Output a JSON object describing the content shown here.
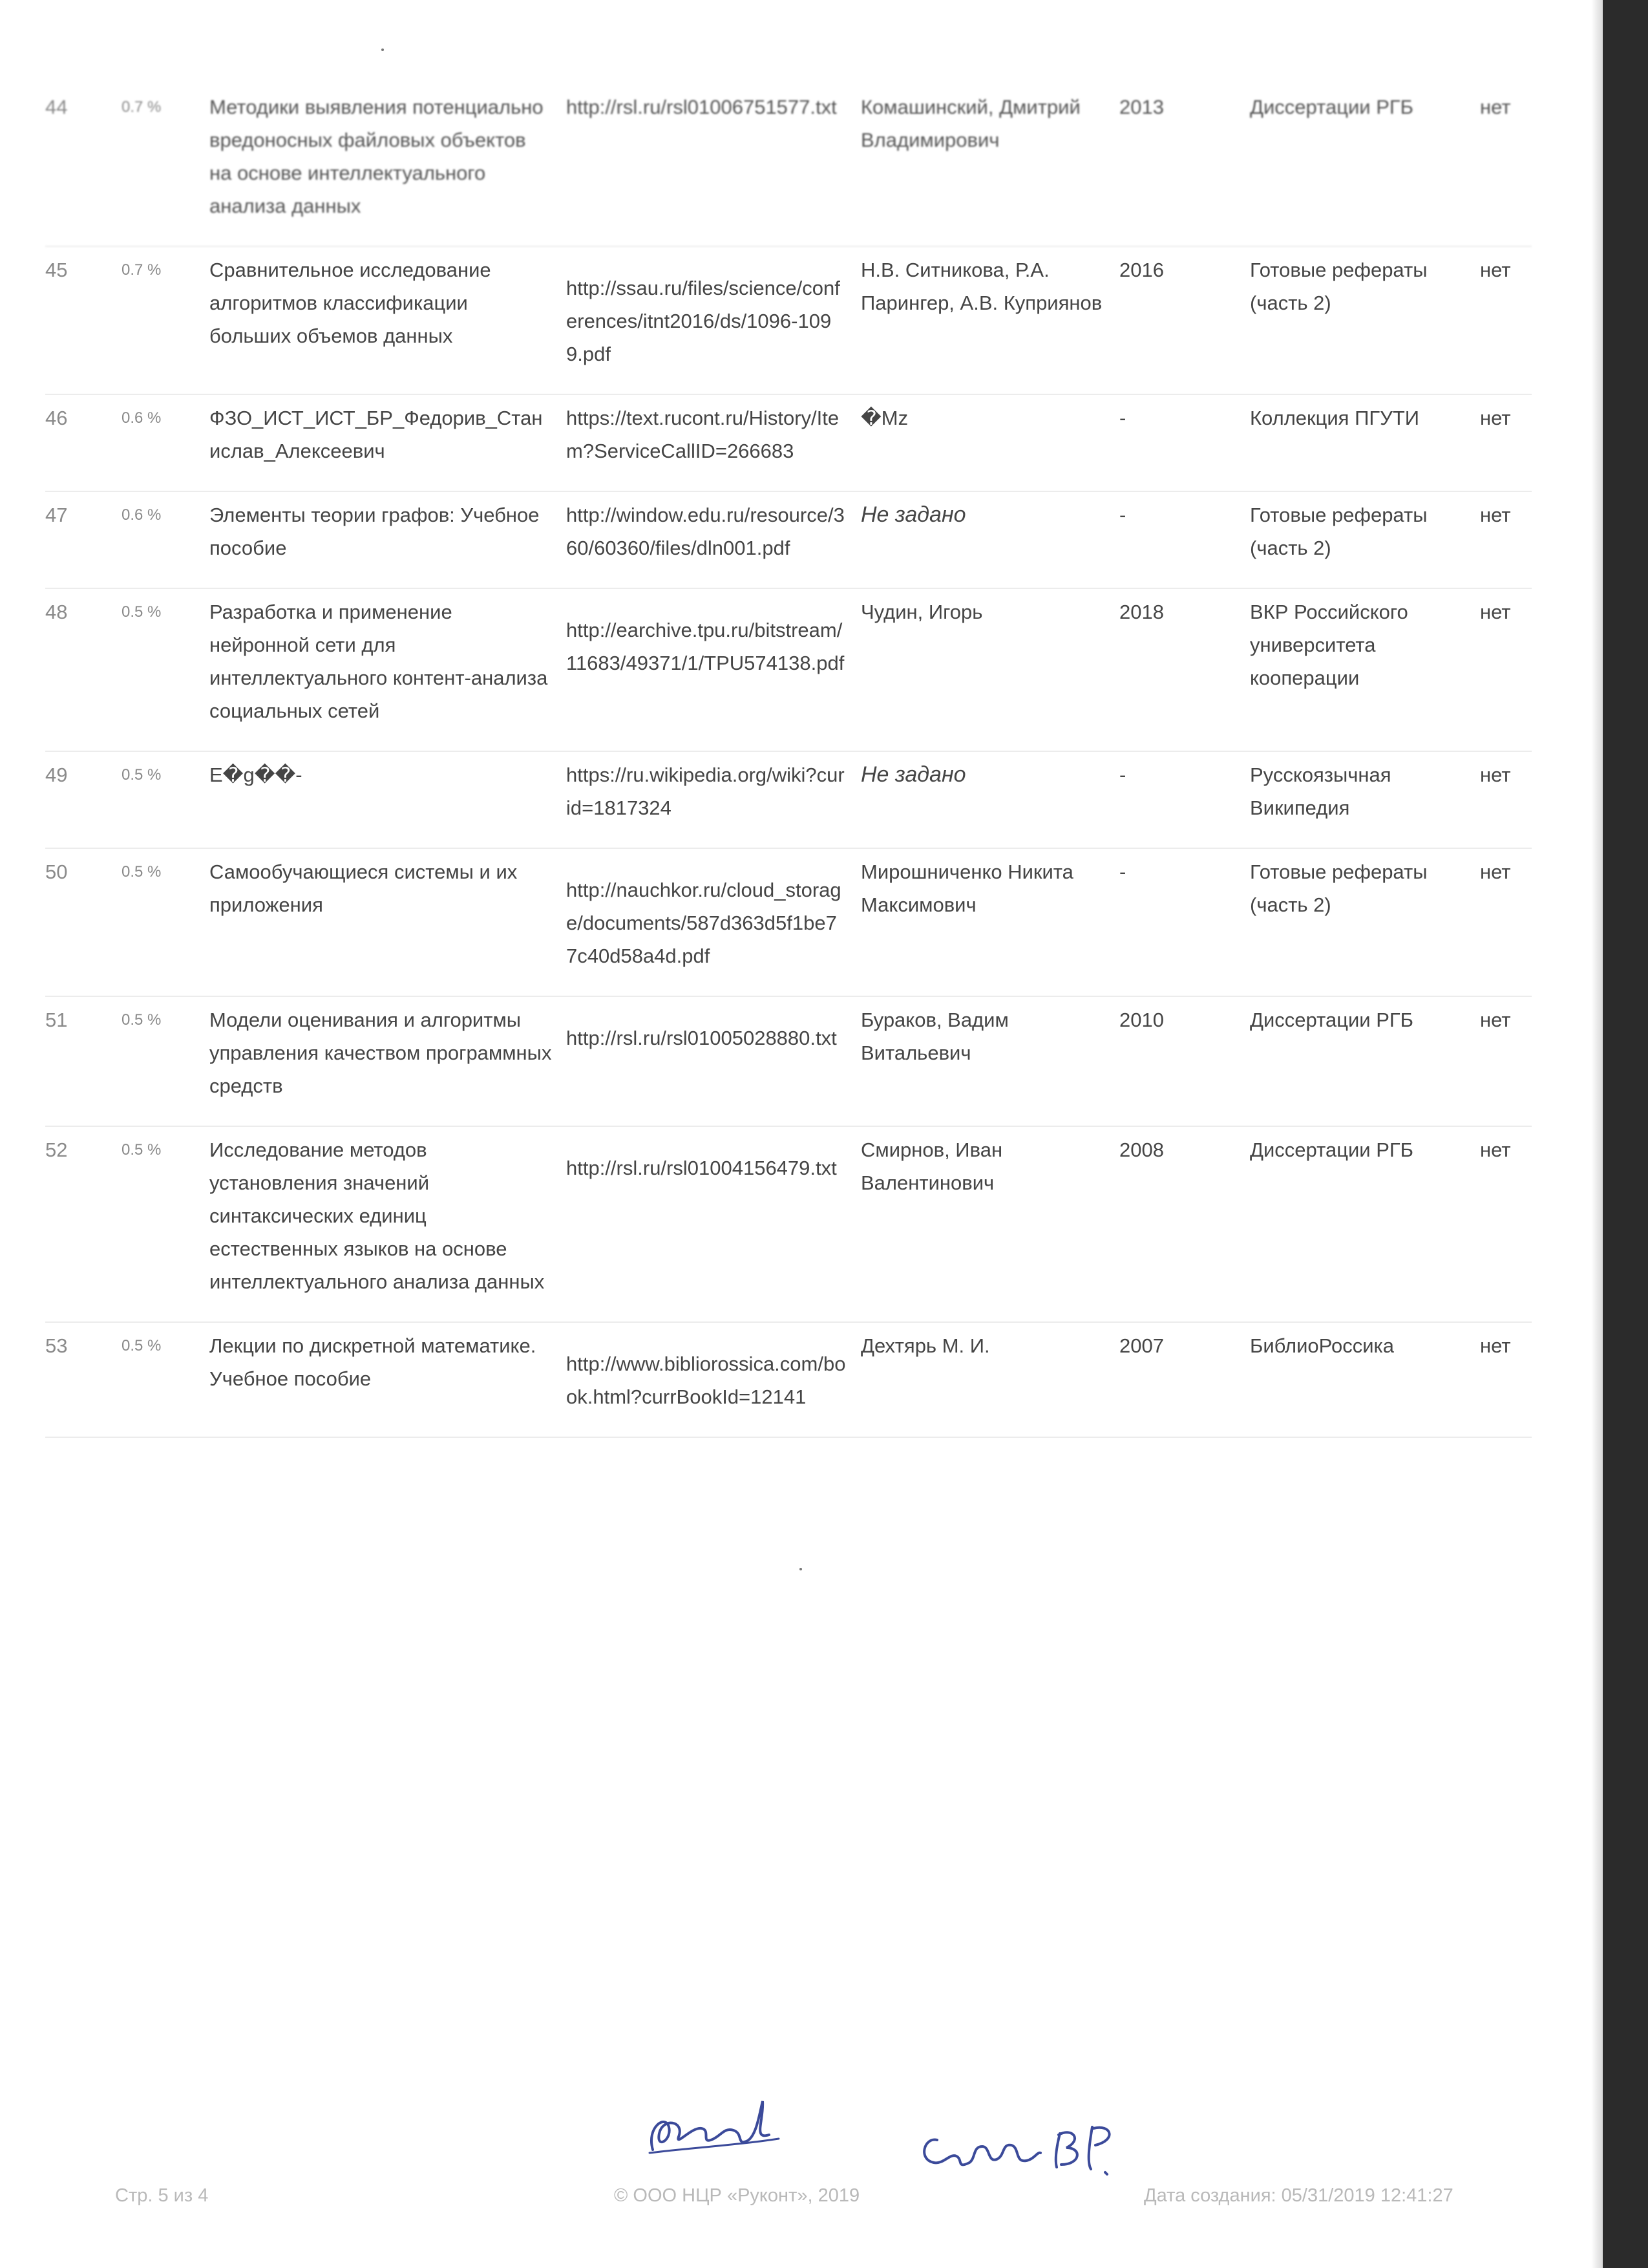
{
  "rows": [
    {
      "num": "44",
      "pct": "0.7 %",
      "title": "Методики выявления потенциально вредоносных файловых объектов на основе интеллектуального анализа данных",
      "url": "http://rsl.ru/rsl01006751577.txt",
      "author": "Комашинский, Дмитрий Владимирович",
      "year": "2013",
      "collection": "Диссертации РГБ",
      "citation": "нет"
    },
    {
      "num": "45",
      "pct": "0.7 %",
      "title": "Сравнительное исследование алгоритмов классификации больших объемов данных",
      "url": "http://ssau.ru/files/science/conferences/itnt2016/ds/1096-1099.pdf",
      "author": "Н.В. Ситникова, Р.А. Парингер, А.В. Куприянов",
      "year": "2016",
      "collection": "Готовые рефераты (часть 2)",
      "citation": "нет"
    },
    {
      "num": "46",
      "pct": "0.6 %",
      "title": "ФЗО_ИСТ_ИСТ_БР_Федорив_Станислав_Алексеевич",
      "url": "https://text.rucont.ru/History/Item?ServiceCallID=266683",
      "author": "�Mz",
      "year": "-",
      "collection": "Коллекция ПГУТИ",
      "citation": "нет"
    },
    {
      "num": "47",
      "pct": "0.6 %",
      "title": "Элементы теории графов: Учебное пособие",
      "url": "http://window.edu.ru/resource/360/60360/files/dln001.pdf",
      "author": "Не задано",
      "year": "-",
      "collection": "Готовые рефераты (часть 2)",
      "citation": "нет"
    },
    {
      "num": "48",
      "pct": "0.5 %",
      "title": "Разработка и применение нейронной сети для интеллектуального контент-анализа социальных сетей",
      "url": "http://earchive.tpu.ru/bitstream/11683/49371/1/TPU574138.pdf",
      "author": "Чудин, Игорь",
      "year": "2018",
      "collection": "ВКР Российского университета кооперации",
      "citation": "нет"
    },
    {
      "num": "49",
      "pct": "0.5 %",
      "title": "E�g��-",
      "url": "https://ru.wikipedia.org/wiki?curid=1817324",
      "author": "Не задано",
      "year": "-",
      "collection": "Русскоязычная Википедия",
      "citation": "нет"
    },
    {
      "num": "50",
      "pct": "0.5 %",
      "title": "Самообучающиеся системы и их приложения",
      "url": "http://nauchkor.ru/cloud_storage/documents/587d363d5f1be77c40d58a4d.pdf",
      "author": "Мирошниченко Никита Максимович",
      "year": "-",
      "collection": "Готовые рефераты (часть 2)",
      "citation": "нет"
    },
    {
      "num": "51",
      "pct": "0.5 %",
      "title": "Модели оценивания и алгоритмы управления качеством программных средств",
      "url": "http://rsl.ru/rsl01005028880.txt",
      "author": "Бураков, Вадим Витальевич",
      "year": "2010",
      "collection": "Диссертации РГБ",
      "citation": "нет"
    },
    {
      "num": "52",
      "pct": "0.5 %",
      "title": "Исследование методов установления значений синтаксических единиц естественных языков на основе интеллектуального анализа данных",
      "url": "http://rsl.ru/rsl01004156479.txt",
      "author": "Смирнов, Иван Валентинович",
      "year": "2008",
      "collection": "Диссертации РГБ",
      "citation": "нет"
    },
    {
      "num": "53",
      "pct": "0.5 %",
      "title": "Лекции по дискретной математике. Учебное пособие",
      "url": "http://www.bibliorossica.com/book.html?currBookId=12141",
      "author": "Дехтярь М. И.",
      "year": "2007",
      "collection": "БиблиоРоссика",
      "citation": "нет"
    }
  ],
  "footer": {
    "page": "Стр. 5 из 4",
    "copyright": "© ООО НЦР «Руконт», 2019",
    "created": "Дата создания: 05/31/2019 12:41:27"
  },
  "signatures": {
    "second": "Сабон В.Р."
  }
}
